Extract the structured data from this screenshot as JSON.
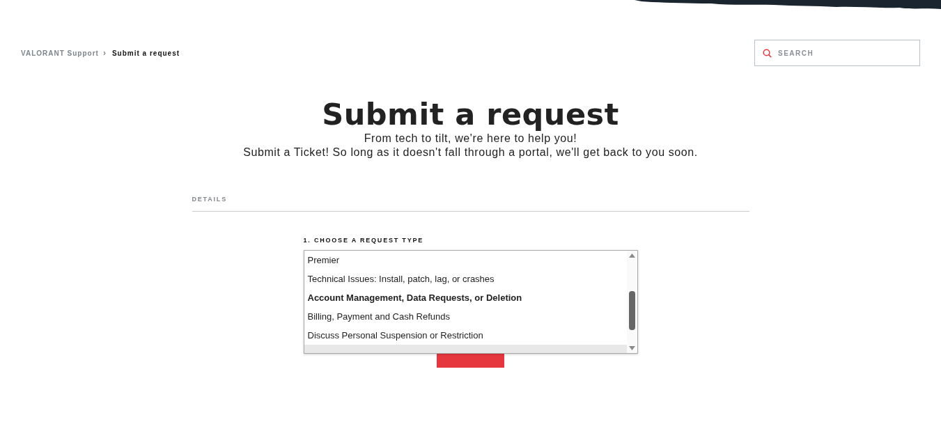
{
  "breadcrumb": [
    {
      "label": "VALORANT Support",
      "current": false
    },
    {
      "label": "›",
      "kind": "separator"
    },
    {
      "label": "Submit a request",
      "current": true
    }
  ],
  "search": {
    "placeholder": "SEARCH"
  },
  "header": {
    "title": "Submit a request",
    "subtitle_lines": [
      "From tech to tilt, we're here to help you!",
      "Submit a Ticket! So long as it doesn't fall through a portal, we'll get back to you soon."
    ]
  },
  "section": {
    "title": "DETAILS"
  },
  "request_type": {
    "label": "1. CHOOSE A REQUEST TYPE",
    "options": [
      {
        "label": "Premier",
        "selected": false,
        "hovered": false
      },
      {
        "label": "Technical Issues: Install, patch, lag, or crashes",
        "selected": false,
        "hovered": false
      },
      {
        "label": "Account Management, Data Requests, or Deletion",
        "selected": true,
        "hovered": false
      },
      {
        "label": "Billing, Payment and Cash Refunds",
        "selected": false,
        "hovered": false
      },
      {
        "label": "Discuss Personal Suspension or Restriction",
        "selected": false,
        "hovered": false
      },
      {
        "hovered": true
      }
    ]
  }
}
